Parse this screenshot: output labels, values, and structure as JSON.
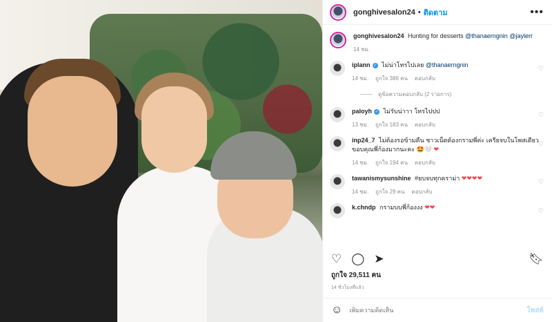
{
  "post": {
    "username": "gonghivesalon24",
    "follow_label": "ติดตาม",
    "more_label": "•••",
    "caption": {
      "username": "gonghivesalon24",
      "text": "Hunting for desserts",
      "mention1": "@thanaerngnin",
      "mention2": "@jaylerr",
      "time": "14 ชม."
    },
    "comments": [
      {
        "username": "iplann",
        "text": "ไม่น่าโทรไปเลย",
        "mention": "@thanaerngnin",
        "time": "14 ชม.",
        "likes": "ถูกใจ 386 คน",
        "reply": "ตอบกลับ"
      },
      {
        "username": "paloyh",
        "text": "ไม่รับน่าาา โทรไปปป",
        "time": "13 ชม.",
        "likes": "ถูกใจ 183 คน",
        "reply": "ตอบกลับ"
      },
      {
        "username": "inp24_7",
        "text": "ไม่ต้องรอข้ามคืน ชาวเน็ตต้องกรามพี่ค่ะ เครียจบในโพสเดียว ขอบคุณพี่ก้องมากนะคะ 🤩🤍",
        "time": "14 ชม.",
        "likes": "ถูกใจ 194 คน",
        "reply": "ตอบกลับ"
      },
      {
        "username": "tawanismysunshine",
        "text": "#ยบจบทุกคราม่า",
        "time": "14 ชม.",
        "likes": "ถูกใจ 29 คน",
        "reply": "ตอบกลับ"
      },
      {
        "username": "k.chndp",
        "text": "กรามบบพี่ก้องงง",
        "time": "",
        "likes": "",
        "reply": ""
      }
    ],
    "view_replies": "ดูข้อความตอบกลับ (2 รายการ)",
    "likes_total": "ถูกใจ 29,511 คน",
    "time_ago": "14 ชั่วโมงที่แล้ว",
    "comment_placeholder": "เพิ่มความคิดเห็น",
    "post_label": "โพสต์"
  }
}
